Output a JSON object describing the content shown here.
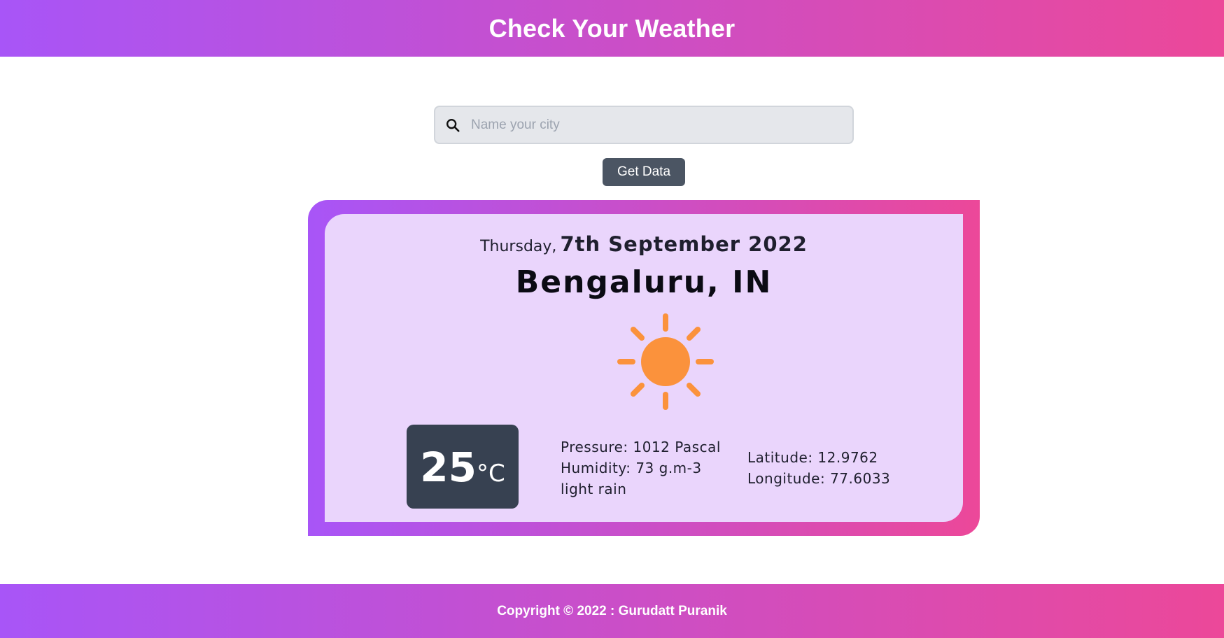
{
  "header": {
    "title": "Check Your Weather",
    "gradient_start": "#a855f7",
    "gradient_end": "#ec4899"
  },
  "search": {
    "icon": "search-icon",
    "placeholder": "Name your city",
    "value": ""
  },
  "button": {
    "label": "Get Data",
    "color": "#4b5563"
  },
  "weather": {
    "day": "Thursday,",
    "date": "7th September 2022",
    "city": "Bengaluru, IN",
    "icon": "sun-icon",
    "icon_color": "#fb923c",
    "temperature": "25",
    "unit": "°C",
    "pressure": "Pressure: 1012 Pascal",
    "humidity": "Humidity: 73 g.m-3",
    "description": "light rain",
    "latitude": "Latitude: 12.9762",
    "longitude": "Longitude: 77.6033",
    "card_background": "#ead5fc",
    "temp_box_color": "#374151"
  },
  "footer": {
    "copyright": "Copyright © 2022 : Gurudatt Puranik"
  }
}
